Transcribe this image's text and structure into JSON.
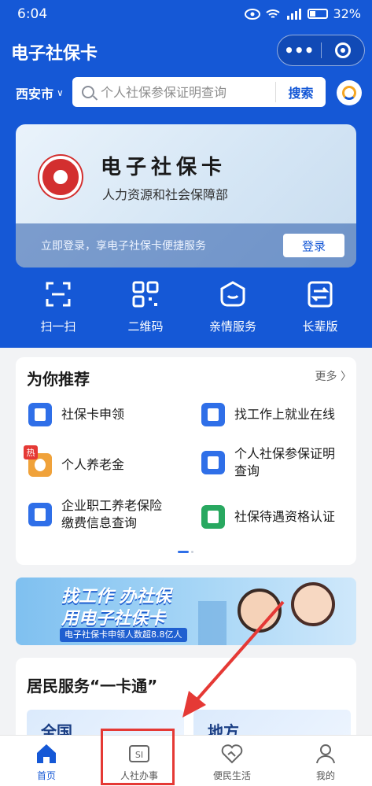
{
  "status_bar": {
    "time": "6:04",
    "battery": "32%"
  },
  "header": {
    "title": "电子社保卡"
  },
  "search": {
    "city": "西安市",
    "placeholder": "个人社保参保证明查询",
    "button": "搜索"
  },
  "card": {
    "title": "电子社保卡",
    "subtitle": "人力资源和社会保障部",
    "hint": "立即登录，享电子社保卡便捷服务",
    "login": "登录"
  },
  "quick_tools": [
    {
      "label": "扫一扫",
      "icon": "scan-icon"
    },
    {
      "label": "二维码",
      "icon": "qr-code-icon"
    },
    {
      "label": "亲情服务",
      "icon": "family-service-icon"
    },
    {
      "label": "长辈版",
      "icon": "elder-mode-icon"
    }
  ],
  "recommend": {
    "title": "为你推荐",
    "more": "更多 〉",
    "items": [
      {
        "label": "社保卡申领",
        "icon": "id-card-icon"
      },
      {
        "label": "找工作上就业在线",
        "icon": "document-icon"
      },
      {
        "label": "个人养老金",
        "icon": "piggy-bank-icon",
        "badge": "热"
      },
      {
        "label_line1": "个人社保参保证明",
        "label_line2": "查询",
        "icon": "certificate-search-icon"
      },
      {
        "label_line1": "企业职工养老保险",
        "label_line2": "缴费信息查询",
        "icon": "pension-search-icon"
      },
      {
        "label": "社保待遇资格认证",
        "icon": "verify-icon"
      }
    ]
  },
  "promo": {
    "line1": "找工作 办社保",
    "line2": "用电子社保卡",
    "line3": "电子社保卡申领人数超8.8亿人"
  },
  "resident": {
    "title": "居民服务“一卡通”",
    "tile1": "全国",
    "tile2": "地方"
  },
  "tabs": [
    {
      "label": "首页",
      "icon": "home-icon",
      "active": true
    },
    {
      "label": "人社办事",
      "icon": "si-icon",
      "active": false
    },
    {
      "label": "便民生活",
      "icon": "heart-handshake-icon",
      "active": false
    },
    {
      "label": "我的",
      "icon": "user-icon",
      "active": false
    }
  ],
  "colors": {
    "primary": "#1558d6",
    "annotation": "#e53935"
  }
}
